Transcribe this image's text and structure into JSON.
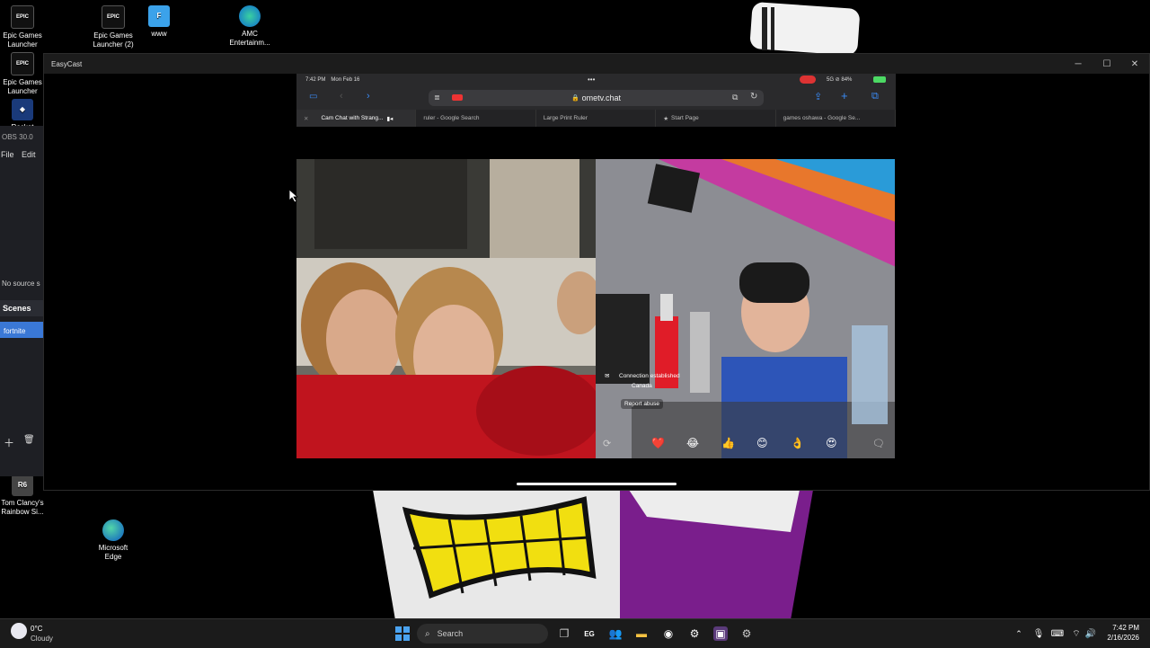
{
  "desktop": {
    "icons": [
      {
        "label_line1": "Epic Games",
        "label_line2": "Launcher"
      },
      {
        "label_line1": "Epic Games",
        "label_line2": "Launcher (2)"
      },
      {
        "label_line1": "www",
        "label_line2": ""
      },
      {
        "label_line1": "AMC",
        "label_line2": "Entertainm..."
      },
      {
        "label_line1": "Epic Games",
        "label_line2": "Launcher"
      },
      {
        "label_line1": "Rocket",
        "label_line2": ""
      },
      {
        "label_line1": "Tom Clancy's",
        "label_line2": "Rainbow Si..."
      },
      {
        "label_line1": "Microsoft",
        "label_line2": "Edge"
      }
    ]
  },
  "obs": {
    "title": "OBS 30.0",
    "menu_file": "File",
    "menu_edit": "Edit",
    "no_source": "No source s",
    "scenes_header": "Scenes",
    "scene_selected": "fortnite"
  },
  "window": {
    "title": "EasyCast"
  },
  "ipad": {
    "time": "7:42 PM",
    "date": "Mon Feb 16",
    "status_right": "5G ⊘ 84%",
    "url": "ometv.chat",
    "tabs": [
      "Cam Chat with Strang...",
      "ruler - Google Search",
      "Large Print Ruler",
      "Start Page",
      "games oshawa - Google Se..."
    ],
    "connection_text": "Connection established",
    "country": "Canada",
    "report": "Report abuse",
    "reactions": [
      "❤️",
      "😂",
      "👍",
      "😊",
      "👌",
      "😍"
    ]
  },
  "taskbar": {
    "weather_temp": "0°C",
    "weather_desc": "Cloudy",
    "search_placeholder": "Search",
    "clock_time": "7:42 PM",
    "clock_date": "2/16/2026"
  },
  "colors": {
    "accent": "#3a78d6",
    "obs_bg": "#1e1f24",
    "taskbar_bg": "#1b1b1b",
    "shirt_red": "#c0141e",
    "shirt_blue": "#2d55b8"
  }
}
